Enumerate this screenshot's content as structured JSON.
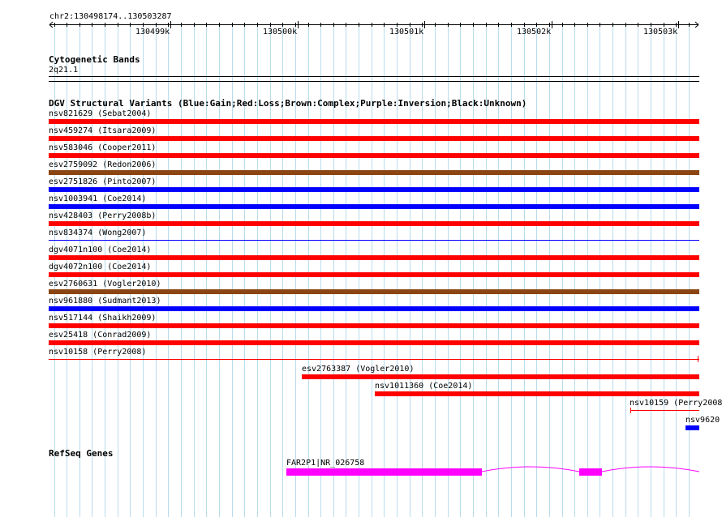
{
  "ruler": {
    "location": "chr2:130498174..130503287",
    "ticks": [
      "130499k",
      "130500k",
      "130501k",
      "130502k",
      "130503k"
    ]
  },
  "cytoband": {
    "title": "Cytogenetic Bands",
    "band": "2q21.1"
  },
  "dgv": {
    "title": "DGV Structural Variants (Blue:Gain;Red:Loss;Brown:Complex;Purple:Inversion;Black:Unknown)",
    "colors": {
      "gain": "#0000ff",
      "loss": "#ff0000",
      "complex": "#8b4513"
    },
    "tracks": [
      {
        "label": "nsv821629 (Sebat2004)",
        "type": "loss"
      },
      {
        "label": "nsv459274 (Itsara2009)",
        "type": "loss"
      },
      {
        "label": "nsv583046 (Cooper2011)",
        "type": "loss"
      },
      {
        "label": "esv2759092 (Redon2006)",
        "type": "complex"
      },
      {
        "label": "esv2751826 (Pinto2007)",
        "type": "gain"
      },
      {
        "label": "nsv1003941 (Coe2014)",
        "type": "gain"
      },
      {
        "label": "nsv428403 (Perry2008b)",
        "type": "loss"
      },
      {
        "label": "nsv834374 (Wong2007)",
        "type": "gain"
      },
      {
        "label": "dgv4071n100 (Coe2014)",
        "type": "loss"
      },
      {
        "label": "dgv4072n100 (Coe2014)",
        "type": "loss"
      },
      {
        "label": "esv2760631 (Vogler2010)",
        "type": "complex"
      },
      {
        "label": "nsv961880 (Sudmant2013)",
        "type": "gain"
      },
      {
        "label": "nsv517144 (Shaikh2009)",
        "type": "loss"
      },
      {
        "label": "esv25418 (Conrad2009)",
        "type": "loss"
      },
      {
        "label": "nsv10158 (Perry2008)",
        "type": "loss"
      },
      {
        "label": "esv2763387 (Vogler2010)",
        "type": "loss"
      },
      {
        "label": "nsv1011360 (Coe2014)",
        "type": "loss"
      },
      {
        "label": "nsv10159 (Perry2008",
        "type": "loss"
      },
      {
        "label": "nsv9620",
        "type": "gain"
      }
    ]
  },
  "refseq": {
    "title": "RefSeq Genes",
    "gene_label": "FAR2P1|NR_026758",
    "color": "#ff00ff"
  }
}
